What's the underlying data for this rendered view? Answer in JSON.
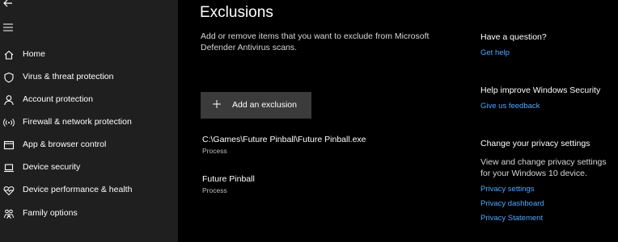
{
  "sidebar": {
    "items": [
      {
        "label": "Home",
        "icon": "home-icon"
      },
      {
        "label": "Virus & threat protection",
        "icon": "shield-icon"
      },
      {
        "label": "Account protection",
        "icon": "person-icon"
      },
      {
        "label": "Firewall & network protection",
        "icon": "wireless-icon"
      },
      {
        "label": "App & browser control",
        "icon": "app-window-icon"
      },
      {
        "label": "Device security",
        "icon": "laptop-icon"
      },
      {
        "label": "Device performance & health",
        "icon": "heart-pulse-icon"
      },
      {
        "label": "Family options",
        "icon": "family-icon"
      }
    ]
  },
  "main": {
    "title": "Exclusions",
    "description": "Add or remove items that you want to exclude from Microsoft Defender Antivirus scans.",
    "add_button_label": "Add an exclusion",
    "exclusions": [
      {
        "path": "C:\\Games\\Future Pinball\\Future Pinball.exe",
        "type": "Process"
      },
      {
        "path": "Future Pinball",
        "type": "Process"
      }
    ]
  },
  "aside": {
    "question_heading": "Have a question?",
    "get_help": "Get help",
    "improve_heading": "Help improve Windows Security",
    "feedback": "Give us feedback",
    "privacy_heading": "Change your privacy settings",
    "privacy_text": "View and change privacy settings for your Windows 10 device.",
    "privacy_settings": "Privacy settings",
    "privacy_dashboard": "Privacy dashboard",
    "privacy_statement": "Privacy Statement"
  },
  "colors": {
    "background": "#000000",
    "sidebar": "#1f1f1f",
    "button": "#3b3b3b",
    "link": "#4ea8ff"
  }
}
